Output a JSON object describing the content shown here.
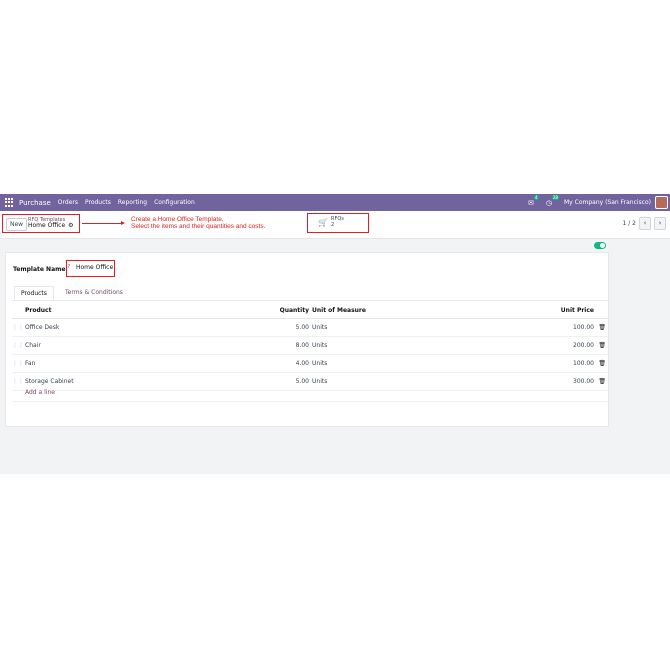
{
  "navbar": {
    "app_name": "Purchase",
    "menu": [
      "Orders",
      "Products",
      "Reporting",
      "Configuration"
    ],
    "chat_badge": "4",
    "activity_badge": "28",
    "company": "My Company (San Francisco)"
  },
  "control_panel": {
    "new_label": "New",
    "breadcrumb_parent": "RFQ Templates",
    "breadcrumb_current": "Home Office",
    "smart_button_label": "RFQs",
    "smart_button_count": "2",
    "pager": "1 / 2"
  },
  "annotation": {
    "line1": "Create a Home Office Template.",
    "line2": "Select the items and their quantities and costs."
  },
  "form": {
    "template_name_label": "Template Name",
    "required_mark": "?",
    "template_name_value": "Home Office",
    "tabs": [
      "Products",
      "Terms & Conditions"
    ],
    "columns": {
      "product": "Product",
      "quantity": "Quantity",
      "uom": "Unit of Measure",
      "unit_price": "Unit Price"
    },
    "rows": [
      {
        "product": "Office Desk",
        "quantity": "5.00",
        "uom": "Units",
        "unit_price": "100.00"
      },
      {
        "product": "Chair",
        "quantity": "8.00",
        "uom": "Units",
        "unit_price": "200.00"
      },
      {
        "product": "Fan",
        "quantity": "4.00",
        "uom": "Units",
        "unit_price": "100.00"
      },
      {
        "product": "Storage Cabinet",
        "quantity": "5.00",
        "uom": "Units",
        "unit_price": "300.00"
      }
    ],
    "add_line": "Add a line"
  },
  "colors": {
    "navbar": "#71639e",
    "accent": "#714b67",
    "highlight": "#e02020",
    "toggle": "#10b981"
  }
}
